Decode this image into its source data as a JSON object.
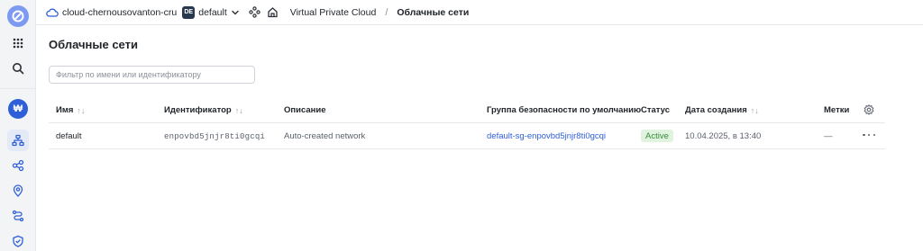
{
  "topbar": {
    "cloud_name": "cloud-chernousovanton-cru",
    "folder_badge": "DE",
    "folder_name": "default",
    "breadcrumb_service": "Virtual Private Cloud",
    "breadcrumb_separator": "/",
    "breadcrumb_current": "Облачные сети"
  },
  "page": {
    "title": "Облачные сети",
    "filter_placeholder": "Фильтр по имени или идентификатору"
  },
  "rail": {
    "service_badge": "₩"
  },
  "table": {
    "columns": {
      "name": "Имя",
      "id": "Идентификатор",
      "description": "Описание",
      "security_group": "Группа безопасности по умолчанию",
      "status": "Статус",
      "created": "Дата создания",
      "labels": "Метки"
    },
    "sort_glyph": "↑↓",
    "rows": [
      {
        "name": "default",
        "id": "enpovbd5jnjr8ti0gcqi",
        "description": "Auto-created network",
        "security_group": "default-sg-enpovbd5jnjr8ti0gcqi",
        "status": "Active",
        "created": "10.04.2025, в 13:40",
        "labels": "—"
      }
    ]
  },
  "colors": {
    "accent": "#2e5fd8",
    "status_active_bg": "#dff3df",
    "status_active_text": "#3a8a3a"
  }
}
